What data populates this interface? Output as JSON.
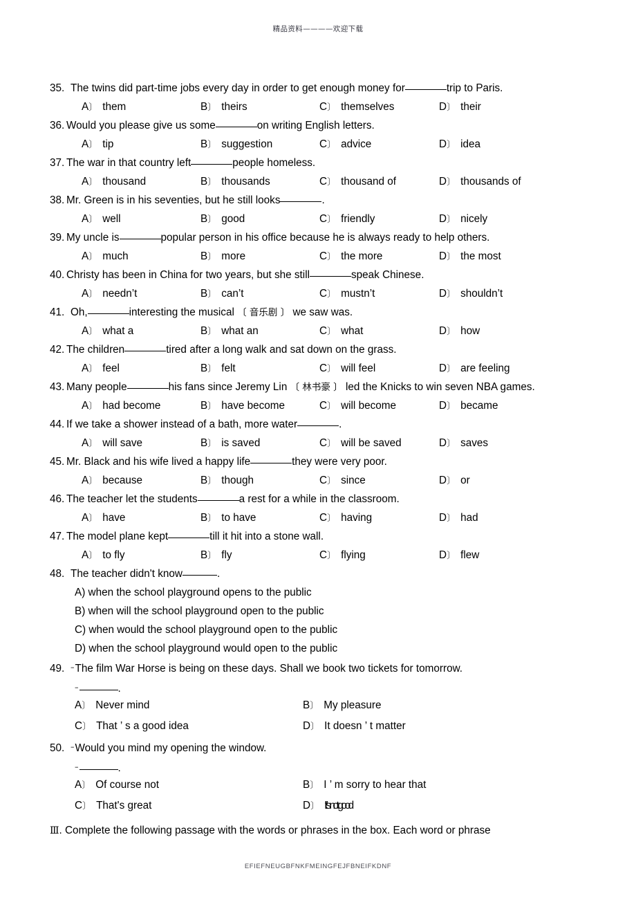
{
  "header": {
    "watermark": "精品资料————欢迎下载"
  },
  "footer": {
    "code": "EFIEFNEUGBFNKFMEINGFEJFBNEIFKDNF"
  },
  "questions": [
    {
      "num": "35.",
      "stem_before": "The twins did part-time jobs every day in order to get enough money for",
      "stem_after": "trip to Paris.",
      "options": [
        {
          "label": "A",
          "text": "them"
        },
        {
          "label": "B",
          "text": "theirs"
        },
        {
          "label": "C",
          "text": "themselves"
        },
        {
          "label": "D",
          "text": "their"
        }
      ]
    },
    {
      "num": "36.",
      "stem_before": "Would you please give us some",
      "stem_after": "on writing English letters.",
      "options": [
        {
          "label": "A",
          "text": "tip"
        },
        {
          "label": "B",
          "text": "suggestion"
        },
        {
          "label": "C",
          "text": "advice"
        },
        {
          "label": "D",
          "text": "idea"
        }
      ]
    },
    {
      "num": "37.",
      "stem_before": "The war in that country left",
      "stem_after": "people homeless.",
      "options": [
        {
          "label": "A",
          "text": "thousand"
        },
        {
          "label": "B",
          "text": "thousands"
        },
        {
          "label": "C",
          "text": "thousand of"
        },
        {
          "label": "D",
          "text": "thousands of"
        }
      ]
    },
    {
      "num": "38.",
      "stem_before": "Mr. Green is in his seventies, but he still looks",
      "stem_after": ".",
      "options": [
        {
          "label": "A",
          "text": "well"
        },
        {
          "label": "B",
          "text": "good"
        },
        {
          "label": "C",
          "text": "friendly"
        },
        {
          "label": "D",
          "text": "nicely"
        }
      ]
    },
    {
      "num": "39.",
      "stem_before": "My uncle is",
      "stem_after": "popular person in his office because he is always ready to help others.",
      "options": [
        {
          "label": "A",
          "text": "much"
        },
        {
          "label": "B",
          "text": "more"
        },
        {
          "label": "C",
          "text": "the more"
        },
        {
          "label": "D",
          "text": "the most"
        }
      ]
    },
    {
      "num": "40.",
      "stem_before": "Christy has been in China for two years, but she still",
      "stem_after": "speak Chinese.",
      "options": [
        {
          "label": "A",
          "text": "needn’t"
        },
        {
          "label": "B",
          "text": "can’t"
        },
        {
          "label": "C",
          "text": "mustn’t"
        },
        {
          "label": "D",
          "text": "shouldn’t"
        }
      ]
    },
    {
      "num": "41.",
      "stem_before": "Oh,",
      "stem_after": "interesting the musical",
      "gloss": "〔 音乐剧 〕",
      "stem_tail": "we saw was.",
      "options": [
        {
          "label": "A",
          "text": "what a"
        },
        {
          "label": "B",
          "text": "what an"
        },
        {
          "label": "C",
          "text": "what"
        },
        {
          "label": "D",
          "text": "how"
        }
      ]
    },
    {
      "num": "42.",
      "stem_before": "The children",
      "stem_after": "tired after a long walk and sat down on the grass.",
      "options": [
        {
          "label": "A",
          "text": "feel"
        },
        {
          "label": "B",
          "text": "felt"
        },
        {
          "label": "C",
          "text": "will feel"
        },
        {
          "label": "D",
          "text": "are feeling"
        }
      ]
    },
    {
      "num": "43.",
      "stem_before": "Many people",
      "stem_after": "his fans since Jeremy Lin",
      "gloss": "〔 林书豪 〕",
      "stem_tail": "led the Knicks to win seven NBA games.",
      "options": [
        {
          "label": "A",
          "text": "had become"
        },
        {
          "label": "B",
          "text": "have become"
        },
        {
          "label": "C",
          "text": "will become"
        },
        {
          "label": "D",
          "text": "became"
        }
      ]
    },
    {
      "num": "44.",
      "stem_before": "If we take a shower instead of a bath, more water",
      "stem_after": ".",
      "options": [
        {
          "label": "A",
          "text": "will save"
        },
        {
          "label": "B",
          "text": "is saved"
        },
        {
          "label": "C",
          "text": "will be saved"
        },
        {
          "label": "D",
          "text": "saves"
        }
      ]
    },
    {
      "num": "45.",
      "stem_before": "Mr. Black and his wife lived a happy life",
      "stem_after": "they were very poor.",
      "options": [
        {
          "label": "A",
          "text": "because"
        },
        {
          "label": "B",
          "text": "though"
        },
        {
          "label": "C",
          "text": "since"
        },
        {
          "label": "D",
          "text": "or"
        }
      ]
    },
    {
      "num": "46.",
      "stem_before": "The teacher let the students",
      "stem_after": "a rest for a while in the classroom.",
      "options": [
        {
          "label": "A",
          "text": "have"
        },
        {
          "label": "B",
          "text": "to have"
        },
        {
          "label": "C",
          "text": "having"
        },
        {
          "label": "D",
          "text": "had"
        }
      ]
    },
    {
      "num": "47.",
      "stem_before": "The model plane kept",
      "stem_after": "till it hit into a stone wall.",
      "options": [
        {
          "label": "A",
          "text": "to fly"
        },
        {
          "label": "B",
          "text": "fly"
        },
        {
          "label": "C",
          "text": "flying"
        },
        {
          "label": "D",
          "text": "flew"
        }
      ]
    }
  ],
  "question48": {
    "num": "48.",
    "stem_before": "The teacher didn't know",
    "stem_after": ".",
    "options": [
      "A) when the school playground opens to the public",
      "B) when will the school playground open to the public",
      "C) when would the school playground open to the public",
      "D) when the school playground would open to the public"
    ]
  },
  "question49": {
    "num": "49.",
    "prompt": "The film War Horse  is being on these days. Shall we book two tickets for tomorrow.",
    "options": [
      {
        "label": "A",
        "text": "Never mind"
      },
      {
        "label": "B",
        "text": "My pleasure"
      },
      {
        "label": "C",
        "text": "That ’ s a good idea"
      },
      {
        "label": "D",
        "text": "It doesn ’ t matter"
      }
    ]
  },
  "question50": {
    "num": "50.",
    "prompt": "Would you mind my opening the window.",
    "options": [
      {
        "label": "A",
        "text": "Of course not"
      },
      {
        "label": "B",
        "text": "I ’ m sorry to hear that"
      },
      {
        "label": "C",
        "text": "That's great"
      },
      {
        "label": "D",
        "text": "It ’s not good"
      }
    ]
  },
  "section3": {
    "roman": "Ⅲ",
    "text": ". Complete the following passage with the words or phrases in the box. Each word or phrase"
  }
}
